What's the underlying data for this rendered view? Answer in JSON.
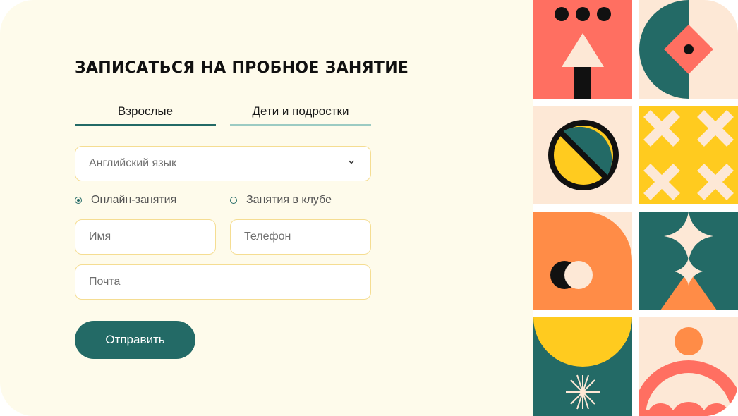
{
  "form": {
    "title": "ЗАПИСАТЬСЯ НА ПРОБНОЕ ЗАНЯТИЕ",
    "tabs": [
      {
        "label": "Взрослые",
        "active": true
      },
      {
        "label": "Дети и подростки",
        "active": false
      }
    ],
    "course_select": {
      "value": "Английский язык"
    },
    "format_options": [
      {
        "label": "Онлайн-занятия",
        "selected": true
      },
      {
        "label": "Занятия в клубе",
        "selected": false
      }
    ],
    "fields": {
      "name_placeholder": "Имя",
      "phone_placeholder": "Телефон",
      "email_placeholder": "Почта"
    },
    "submit_label": "Отправить"
  },
  "colors": {
    "accent": "#236a66",
    "card_bg": "#fefbeb",
    "field_border": "#f5dd92",
    "coral": "#ff6f61",
    "yellow": "#ffcb1f",
    "orange": "#ff8c47",
    "cream": "#fde8d6"
  },
  "decor": {
    "tiles": [
      "arrow-tile",
      "diamond-circle-tile",
      "ring-tile",
      "cross-tile",
      "eyes-arch-tile",
      "star-tile",
      "sun-snowflake-tile",
      "sunrise-tile"
    ]
  }
}
